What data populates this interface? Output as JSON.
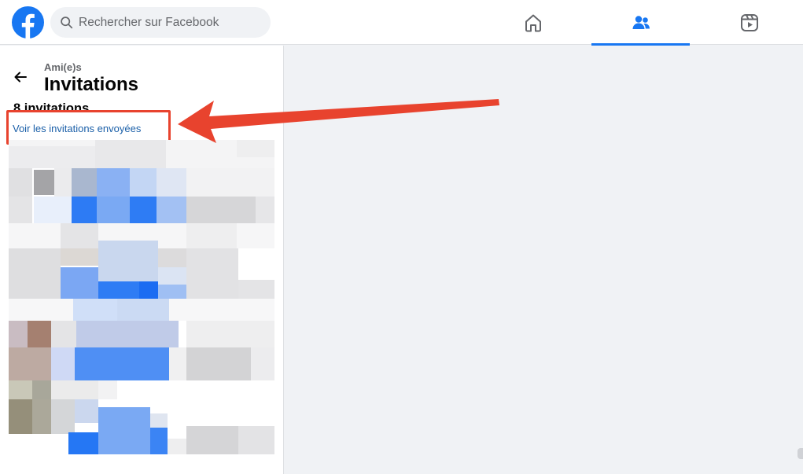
{
  "search": {
    "placeholder": "Rechercher sur Facebook"
  },
  "nav": {
    "tabs": [
      {
        "icon": "home-icon",
        "active": false
      },
      {
        "icon": "friends-icon",
        "active": true
      },
      {
        "icon": "reels-icon",
        "active": false
      }
    ]
  },
  "panel": {
    "breadcrumb": "Ami(e)s",
    "title": "Invitations",
    "count": "8 invitations",
    "sent_link": "Voir les invitations envoyées"
  },
  "colors": {
    "accent": "#1877f2",
    "annotation": "#e8432e",
    "background": "#f0f2f5"
  }
}
